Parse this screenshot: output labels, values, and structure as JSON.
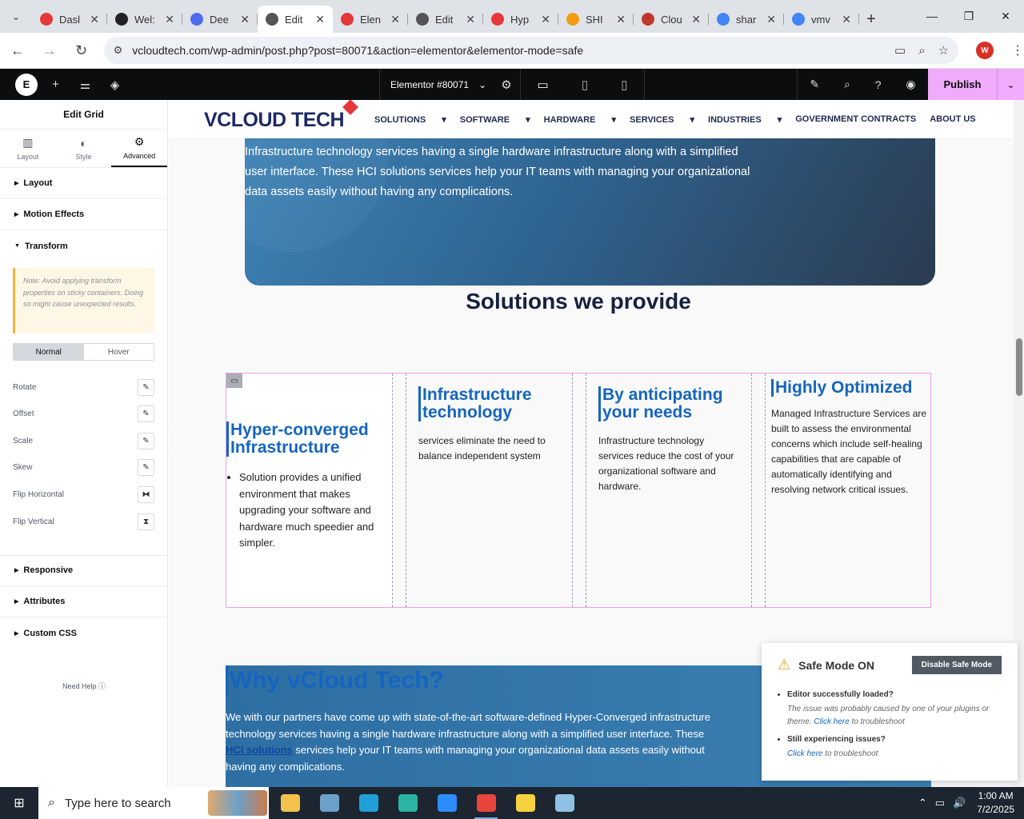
{
  "browser": {
    "tabs": [
      {
        "label": "Dasl",
        "color": "#e5383b",
        "active": false
      },
      {
        "label": "Wel:",
        "color": "#222222",
        "active": false
      },
      {
        "label": "Dee",
        "color": "#4f6bed",
        "active": false
      },
      {
        "label": "Edit",
        "color": "#555555",
        "active": true
      },
      {
        "label": "Elen",
        "color": "#e5383b",
        "active": false
      },
      {
        "label": "Edit",
        "color": "#555555",
        "active": false
      },
      {
        "label": "Hyp",
        "color": "#e5383b",
        "active": false
      },
      {
        "label": "SHI",
        "color": "#f39c12",
        "active": false
      },
      {
        "label": "Clou",
        "color": "#c0392b",
        "active": false
      },
      {
        "label": "shar",
        "color": "#4285f4",
        "active": false
      },
      {
        "label": "vmv",
        "color": "#4285f4",
        "active": false
      }
    ],
    "url": "vcloudtech.com/wp-admin/post.php?post=80071&action=elementor&elementor-mode=safe",
    "profile_initial": "W"
  },
  "elementor": {
    "document_title": "Elementor #80071",
    "publish_label": "Publish"
  },
  "panel": {
    "title": "Edit Grid",
    "tabs": [
      "Layout",
      "Style",
      "Advanced"
    ],
    "sections": {
      "layout": "Layout",
      "motion": "Motion Effects",
      "transform": "Transform",
      "responsive": "Responsive",
      "attributes": "Attributes",
      "custom_css": "Custom CSS"
    },
    "note": "Note: Avoid applying transform properties on sticky containers. Doing so might cause unexpected results.",
    "states": [
      "Normal",
      "Hover"
    ],
    "controls": [
      "Rotate",
      "Offset",
      "Scale",
      "Skew",
      "Flip Horizontal",
      "Flip Vertical"
    ],
    "need_help": "Need Help"
  },
  "site": {
    "logo": "VCLOUD TECH",
    "nav": [
      "SOLUTIONS",
      "SOFTWARE",
      "HARDWARE",
      "SERVICES",
      "INDUSTRIES",
      "GOVERNMENT CONTRACTS",
      "ABOUT US"
    ],
    "hero_text": "Infrastructure technology services having a single hardware infrastructure along with a simplified user interface. These HCI solutions services help your IT teams with managing your organizational data assets easily without having any complications.",
    "solutions_title": "Solutions we provide",
    "cards": [
      {
        "title": "Hyper-converged Infrastructure",
        "body": "Solution provides a unified environment that makes upgrading your software and hardware much speedier and simpler."
      },
      {
        "title": "Infrastructure technology",
        "body": "services eliminate the need to balance independent system"
      },
      {
        "title": "By anticipating your needs",
        "body": " Infrastructure technology services reduce the cost of your organizational software and hardware."
      },
      {
        "title": "Highly Optimized",
        "body": "Managed Infrastructure Services are built to assess the environmental concerns which include self-healing capabilities that are capable of automatically identifying and resolving network critical issues."
      }
    ],
    "why_title": "Why vCloud Tech?",
    "why_text_1": "We with our partners have come up with state-of-the-art software-defined Hyper-Converged infrastructure technology services having a single hardware infrastructure along with a simplified user interface. These ",
    "why_link": "HCI solutions",
    "why_text_2": " services help your IT teams with managing your organizational data assets easily without having any complications."
  },
  "safe_mode": {
    "title": "Safe Mode ON",
    "disable_label": "Disable Safe Mode",
    "item1_title": "Editor successfully loaded?",
    "item1_text": "The issue was probably caused by one of your plugins or theme.",
    "item1_link": "Click here",
    "item1_tail": " to troubleshoot",
    "item2_title": "Still experiencing issues?",
    "item2_link": "Click here",
    "item2_tail": " to troubleshoot"
  },
  "taskbar": {
    "search_placeholder": "Type here to search",
    "time": "1:00 AM",
    "date": "7/2/2025",
    "apps": [
      {
        "name": "file-explorer",
        "color": "#f2c14e"
      },
      {
        "name": "app-2",
        "color": "#6da0c9"
      },
      {
        "name": "edge",
        "color": "#1fa0d8"
      },
      {
        "name": "app-4",
        "color": "#2bb3a3"
      },
      {
        "name": "zoom",
        "color": "#2d8cff"
      },
      {
        "name": "chrome",
        "color": "#e8453c"
      },
      {
        "name": "sticky-notes",
        "color": "#f7d23e"
      },
      {
        "name": "app-8",
        "color": "#8fc1e3"
      }
    ]
  },
  "colors": {
    "accent_blue": "#1565c0",
    "publish_pink": "#f0abfc",
    "elementor_bar": "#0c0d0e"
  }
}
